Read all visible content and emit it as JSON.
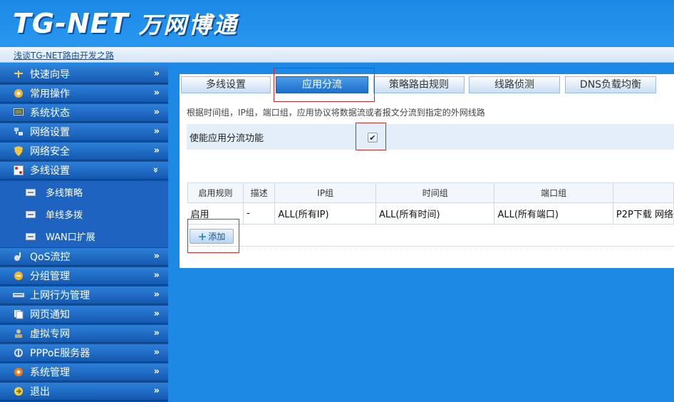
{
  "header": {
    "logo_en": "TG-NET",
    "logo_cn": "万网博通"
  },
  "linkbar": {
    "link": "浅谈TG-NET路由开发之路"
  },
  "sidebar": {
    "items": [
      {
        "label": "快速向导",
        "icon": "wand-icon",
        "arrow": "»"
      },
      {
        "label": "常用操作",
        "icon": "gear-icon",
        "arrow": "»"
      },
      {
        "label": "系统状态",
        "icon": "monitor-icon",
        "arrow": "»"
      },
      {
        "label": "网络设置",
        "icon": "network-icon",
        "arrow": "»"
      },
      {
        "label": "网络安全",
        "icon": "shield-icon",
        "arrow": "»"
      },
      {
        "label": "多线设置",
        "icon": "multiline-icon",
        "arrow": "»"
      },
      {
        "label": "QoS流控",
        "icon": "qos-icon",
        "arrow": "»"
      },
      {
        "label": "分组管理",
        "icon": "group-icon",
        "arrow": "»"
      },
      {
        "label": "上网行为管理",
        "icon": "switch-icon",
        "arrow": "»"
      },
      {
        "label": "网页通知",
        "icon": "webpage-icon",
        "arrow": "»"
      },
      {
        "label": "虚拟专网",
        "icon": "vpn-icon",
        "arrow": "»"
      },
      {
        "label": "PPPoE服务器",
        "icon": "server-icon",
        "arrow": "»"
      },
      {
        "label": "系统管理",
        "icon": "settings-icon",
        "arrow": "»"
      },
      {
        "label": "退出",
        "icon": "exit-icon",
        "arrow": "»"
      }
    ],
    "expanded_arrow": "»",
    "subitems": [
      {
        "label": "多线策略"
      },
      {
        "label": "单线多拨"
      },
      {
        "label": "WAN口扩展"
      }
    ]
  },
  "tabs": [
    {
      "label": "多线设置",
      "active": false
    },
    {
      "label": "应用分流",
      "active": true
    },
    {
      "label": "策略路由规则",
      "active": false
    },
    {
      "label": "线路侦测",
      "active": false
    },
    {
      "label": "DNS负载均衡",
      "active": false
    }
  ],
  "content": {
    "description": "根据时间组，IP组，端口组，应用协议将数据流或者报文分流到指定的外网线路",
    "enable_label": "使能应用分流功能",
    "enable_checked": "✔",
    "table": {
      "headers": [
        "启用规则",
        "描述",
        "IP组",
        "时间组",
        "端口组",
        ""
      ],
      "rows": [
        [
          "启用",
          "-",
          "ALL(所有IP)",
          "ALL(所有时间)",
          "ALL(所有端口)",
          "P2P下载 网络"
        ]
      ]
    },
    "add_plus": "+",
    "add_label": "添加"
  },
  "colors": {
    "accent": "#1e88e5",
    "highlight": "#d3262e"
  }
}
